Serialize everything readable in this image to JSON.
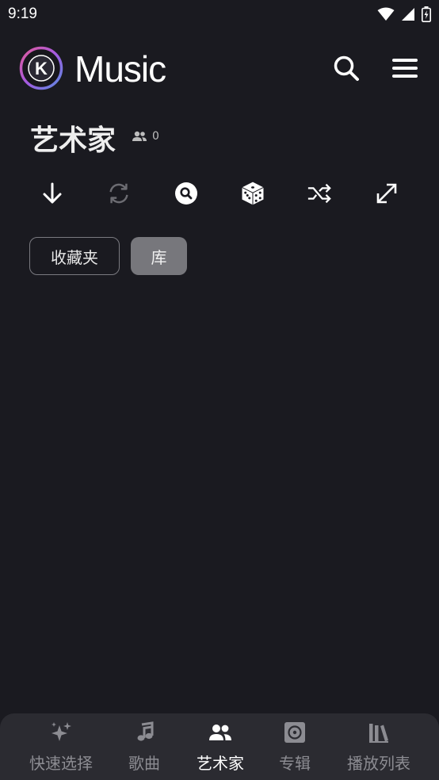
{
  "status": {
    "time": "9:19",
    "icons": [
      "wifi-icon",
      "cell-signal-icon",
      "battery-icon"
    ]
  },
  "appbar": {
    "logo_letter": "K",
    "title": "Music",
    "actions": [
      "search-icon",
      "menu-icon"
    ]
  },
  "page": {
    "title": "艺术家",
    "count": "0"
  },
  "toolbar": {
    "items": [
      "arrow-down-icon",
      "refresh-icon",
      "search-circle-icon",
      "dice-icon",
      "shuffle-icon",
      "expand-icon"
    ],
    "refresh_disabled": true
  },
  "chips": [
    {
      "label": "收藏夹",
      "selected": false
    },
    {
      "label": "库",
      "selected": true
    }
  ],
  "nav": {
    "active": "艺术家",
    "items": [
      {
        "label": "快速选择",
        "icon": "sparkles-icon"
      },
      {
        "label": "歌曲",
        "icon": "music-note-icon"
      },
      {
        "label": "艺术家",
        "icon": "people-icon"
      },
      {
        "label": "专辑",
        "icon": "album-icon"
      },
      {
        "label": "播放列表",
        "icon": "library-icon"
      }
    ]
  },
  "colors": {
    "background": "#1a1a20",
    "nav_background": "#2b2b31",
    "chip_selected": "#77777c",
    "logo_ring": "#b05ad6"
  }
}
